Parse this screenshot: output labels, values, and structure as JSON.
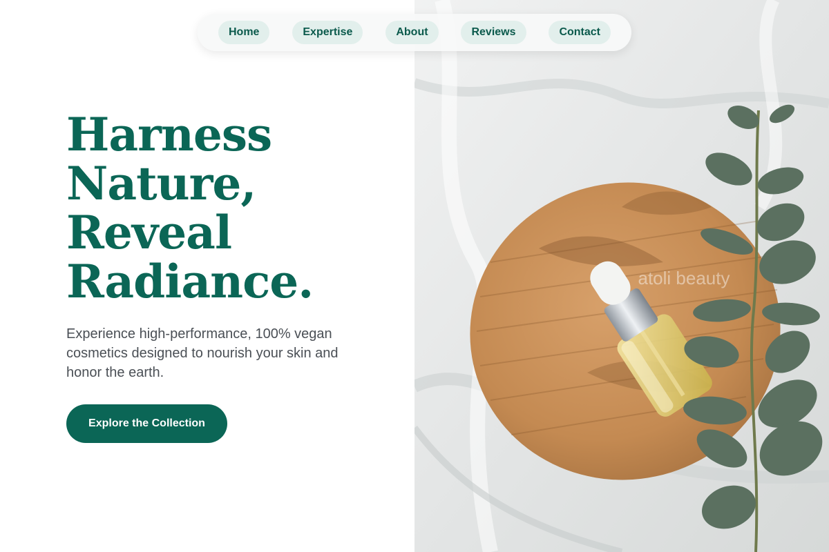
{
  "nav": {
    "items": [
      {
        "label": "Home"
      },
      {
        "label": "Expertise"
      },
      {
        "label": "About"
      },
      {
        "label": "Reviews"
      },
      {
        "label": "Contact"
      }
    ]
  },
  "hero": {
    "title_lines": [
      "Harness",
      "Nature,",
      "Reveal",
      "Radiance."
    ],
    "subtitle": "Experience high-performance, 100% vegan cosmetics designed to nourish your skin and honor the earth.",
    "cta_label": "Explore the Collection"
  },
  "photo": {
    "watermark": "atoli beauty"
  },
  "colors": {
    "brand_green": "#0b6656",
    "nav_pill_bg": "#e2efec",
    "body_text": "#4a4f55"
  }
}
